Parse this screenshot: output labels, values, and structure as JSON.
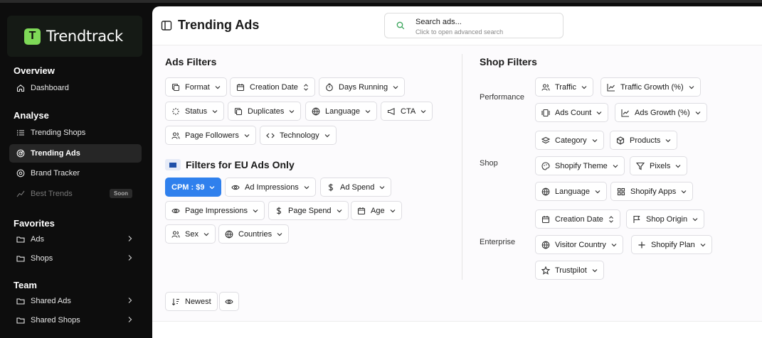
{
  "app": {
    "name": "Trendtrack",
    "logo_letter": "T",
    "accent": "#7ed957"
  },
  "sidebar": {
    "overview": {
      "title": "Overview",
      "items": [
        {
          "label": "Dashboard",
          "icon": "home-icon"
        }
      ]
    },
    "analyse": {
      "title": "Analyse",
      "items": [
        {
          "label": "Trending Shops",
          "icon": "list-icon"
        },
        {
          "label": "Trending Ads",
          "icon": "radar-icon",
          "active": true
        },
        {
          "label": "Brand Tracker",
          "icon": "target-icon"
        },
        {
          "label": "Best Trends",
          "icon": "trend-icon",
          "badge": "Soon",
          "muted": true
        }
      ]
    },
    "favorites": {
      "title": "Favorites",
      "items": [
        {
          "label": "Ads",
          "icon": "folder-icon"
        },
        {
          "label": "Shops",
          "icon": "folder-icon"
        }
      ]
    },
    "team": {
      "title": "Team",
      "items": [
        {
          "label": "Shared Ads",
          "icon": "folder-icon"
        },
        {
          "label": "Shared Shops",
          "icon": "folder-icon"
        }
      ]
    }
  },
  "header": {
    "title": "Trending Ads",
    "search": {
      "placeholder": "Search ads...",
      "subtitle": "Click to open advanced search"
    }
  },
  "ads_filters": {
    "title": "Ads Filters",
    "chips": [
      "Format",
      "Creation Date",
      "Days Running",
      "Status",
      "Duplicates",
      "Language",
      "CTA",
      "Page Followers",
      "Technology"
    ]
  },
  "eu_filters": {
    "title": "Filters for EU Ads Only",
    "cpm": "CPM : $9",
    "chips": [
      "Ad Impressions",
      "Ad Spend",
      "Page Impressions",
      "Page Spend",
      "Age",
      "Sex",
      "Countries"
    ]
  },
  "shop_filters": {
    "title": "Shop Filters",
    "performance_label": "Performance",
    "shop_label": "Shop",
    "enterprise_label": "Enterprise",
    "chips": [
      "Traffic",
      "Traffic Growth (%)",
      "Ads Count",
      "Ads Growth (%)",
      "Category",
      "Products",
      "Shopify Theme",
      "Pixels",
      "Language",
      "Shopify Apps",
      "Creation Date",
      "Shop Origin",
      "Visitor Country",
      "Shopify Plan",
      "Trustpilot"
    ]
  },
  "sort": {
    "label": "Newest"
  }
}
